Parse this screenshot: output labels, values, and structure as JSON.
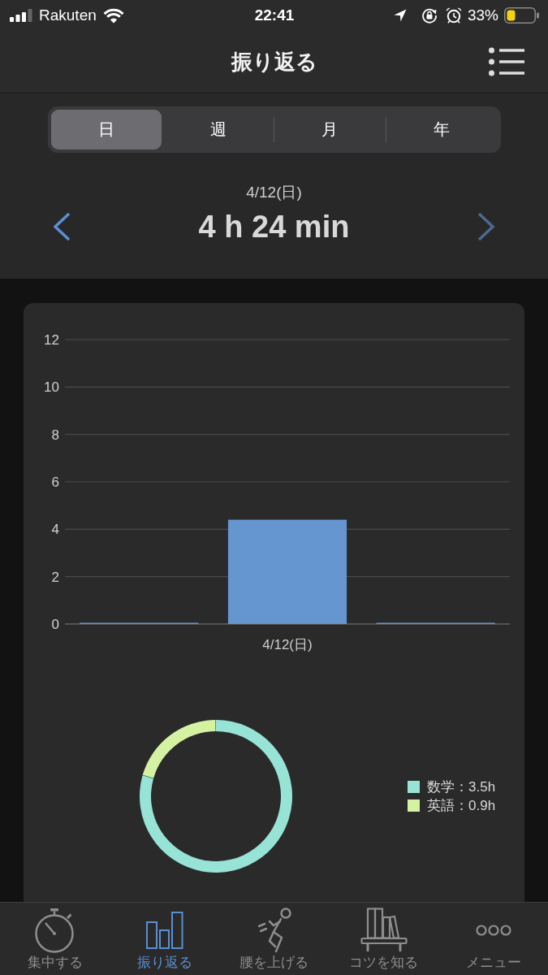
{
  "status_bar": {
    "carrier": "Rakuten",
    "time": "22:41",
    "battery": "33%"
  },
  "nav_bar": {
    "title": "振り返る"
  },
  "period_tabs": [
    {
      "label": "日",
      "selected": true
    },
    {
      "label": "週",
      "selected": false
    },
    {
      "label": "月",
      "selected": false
    },
    {
      "label": "年",
      "selected": false
    }
  ],
  "date_nav": {
    "date": "4/12(日)",
    "total": "4 h 24 min",
    "prev": {
      "disabled": false
    },
    "next": {
      "disabled": true
    }
  },
  "bar_chart": {
    "chart_data": {
      "type": "bar",
      "categories": [
        null,
        "4/12(日)",
        null
      ],
      "series": [
        {
          "color": "#6596cf",
          "values": [
            0,
            4.4,
            0
          ]
        }
      ],
      "ylim": [
        0,
        12
      ],
      "yticks": [
        0,
        2,
        4,
        6,
        8,
        10,
        12
      ],
      "grid": true
    }
  },
  "donut_chart": {
    "chart_data": {
      "type": "donut",
      "categories": [
        "数学",
        "英語"
      ],
      "values": [
        79.5,
        20.5
      ]
    },
    "legend": [
      {
        "reading": "：3.5h",
        "color": "#97e3d6"
      },
      {
        "reading": "：0.9h",
        "color": "#d5f2a3"
      }
    ]
  },
  "tab_bar": [
    {
      "label": "集中する",
      "selected": false
    },
    {
      "label": "振り返る",
      "selected": true
    },
    {
      "label": "腰を上げる",
      "selected": false
    },
    {
      "label": "コツを知る",
      "selected": false
    },
    {
      "label": "メニュー",
      "selected": false
    }
  ]
}
